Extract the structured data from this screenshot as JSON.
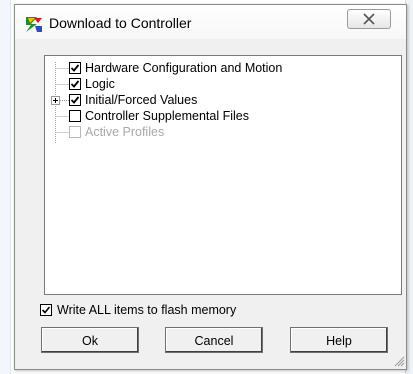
{
  "dialog": {
    "title": "Download to Controller"
  },
  "tree": {
    "items": [
      {
        "label": "Hardware Configuration and Motion",
        "checked": true,
        "enabled": true,
        "expandable": false
      },
      {
        "label": "Logic",
        "checked": true,
        "enabled": true,
        "expandable": false
      },
      {
        "label": "Initial/Forced Values",
        "checked": true,
        "enabled": true,
        "expandable": true
      },
      {
        "label": "Controller Supplemental Files",
        "checked": false,
        "enabled": true,
        "expandable": false
      },
      {
        "label": "Active Profiles",
        "checked": false,
        "enabled": false,
        "expandable": false
      }
    ]
  },
  "flash": {
    "label": "Write ALL items to flash memory",
    "checked": true
  },
  "buttons": {
    "ok": "Ok",
    "cancel": "Cancel",
    "help": "Help"
  },
  "icons": {
    "app": "app-logo-icon",
    "close": "close-icon",
    "check": "check-icon",
    "expand": "plus-expander-icon",
    "grip": "resize-grip-icon"
  }
}
